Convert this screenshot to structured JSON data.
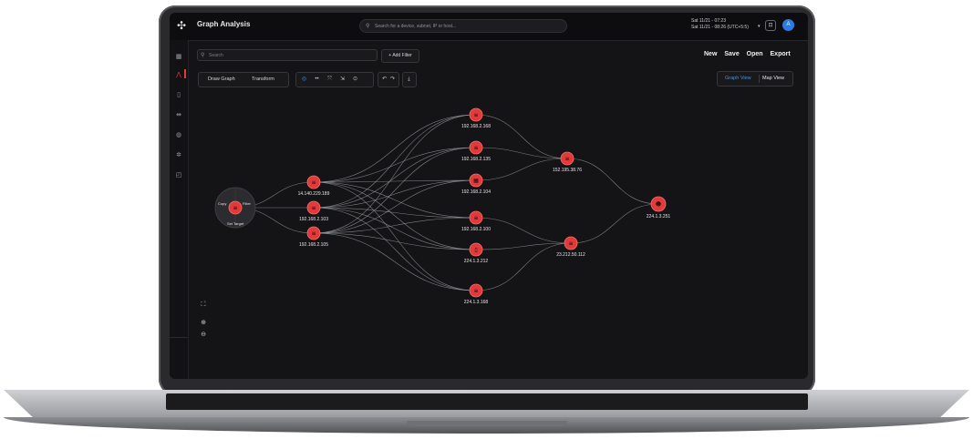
{
  "app": {
    "title": "Graph Analysis"
  },
  "topbar": {
    "search_placeholder": "Search for a device, subnet, IP or host...",
    "date_line1": "Sat 11/21 - 07:23",
    "date_line2": "Sat 11/21 - 08:26 (UTC+5:5)",
    "avatar_initial": "A"
  },
  "panel": {
    "search_placeholder": "Search",
    "add_filter_label": "+ Add Filter",
    "actions": {
      "new": "New",
      "save": "Save",
      "open": "Open",
      "export": "Export"
    },
    "tabs": {
      "draw_graph": "Draw Graph",
      "transform": "Transform"
    },
    "view_toggle": {
      "graph_view": "Graph View",
      "map_view": "Map View",
      "active": "graph_view"
    }
  },
  "graph": {
    "selected_node_menu": {
      "copy": "Copy",
      "filter": "Filter",
      "set_target": "Set Target"
    },
    "accent_color": "#e03a3a",
    "nodes": [
      {
        "id": "source",
        "label": "",
        "icon": "server-icon"
      },
      {
        "id": "n1",
        "label": "14.140.229.189",
        "icon": "server-icon"
      },
      {
        "id": "n2",
        "label": "192.168.2.103",
        "icon": "server-icon"
      },
      {
        "id": "n3",
        "label": "192.168.2.105",
        "icon": "server-icon"
      },
      {
        "id": "n4",
        "label": "192.168.2.168",
        "icon": "server-icon"
      },
      {
        "id": "n5",
        "label": "192.168.2.135",
        "icon": "server-icon"
      },
      {
        "id": "n6",
        "label": "192.168.2.104",
        "icon": "grid-icon"
      },
      {
        "id": "n7",
        "label": "192.168.2.100",
        "icon": "server-icon"
      },
      {
        "id": "n8",
        "label": "224.1.3.212",
        "icon": "phone-icon"
      },
      {
        "id": "n9",
        "label": "224.1.3.168",
        "icon": "server-icon"
      },
      {
        "id": "n10",
        "label": "152.195.38.76",
        "icon": "server-icon"
      },
      {
        "id": "n11",
        "label": "23.212.50.112",
        "icon": "server-icon"
      },
      {
        "id": "n12",
        "label": "224.1.3.251",
        "icon": "user-icon"
      }
    ]
  }
}
